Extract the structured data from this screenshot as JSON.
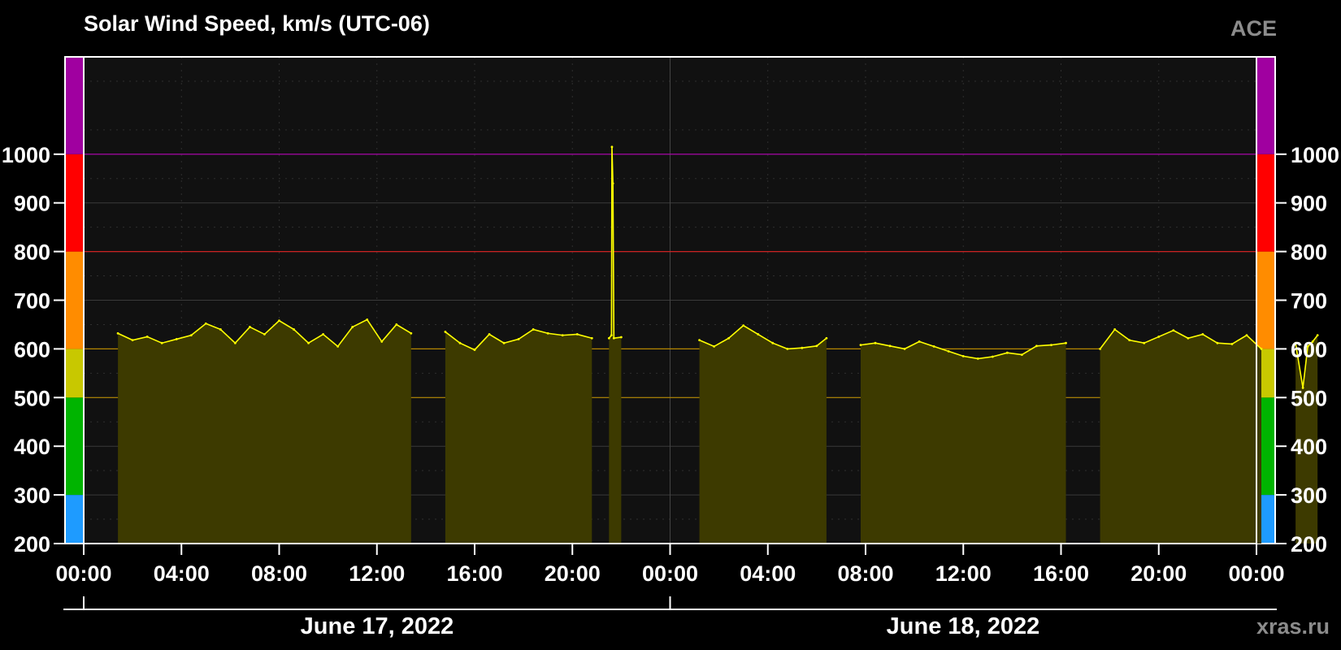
{
  "chart_data": {
    "type": "area",
    "title": "Solar Wind Speed, km/s (UTC-06)",
    "source_label": "ACE",
    "watermark": "xras.ru",
    "ylim": [
      200,
      1200
    ],
    "y_ticks": [
      200,
      300,
      400,
      500,
      600,
      700,
      800,
      900,
      1000
    ],
    "y_tick_labels": [
      "200",
      "300",
      "400",
      "500",
      "600",
      "700",
      "800",
      "900",
      "1000"
    ],
    "x_range_hours": [
      0,
      48
    ],
    "x_tick_hours": [
      0,
      4,
      8,
      12,
      16,
      20,
      24,
      28,
      32,
      36,
      40,
      44,
      48
    ],
    "x_tick_labels": [
      "00:00",
      "04:00",
      "08:00",
      "12:00",
      "16:00",
      "20:00",
      "00:00",
      "04:00",
      "08:00",
      "12:00",
      "16:00",
      "20:00",
      "00:00"
    ],
    "date_labels": [
      "June 17, 2022",
      "June 18, 2022"
    ],
    "threshold_lines": [
      {
        "value": 500,
        "color": "#b38600"
      },
      {
        "value": 600,
        "color": "#b38600"
      },
      {
        "value": 800,
        "color": "#cc2222"
      },
      {
        "value": 1000,
        "color": "#b000b0"
      }
    ],
    "color_bands": [
      {
        "from": 200,
        "to": 300,
        "color": "#1e9bff"
      },
      {
        "from": 300,
        "to": 500,
        "color": "#00b400"
      },
      {
        "from": 500,
        "to": 600,
        "color": "#c8c800"
      },
      {
        "from": 600,
        "to": 800,
        "color": "#ff8c00"
      },
      {
        "from": 800,
        "to": 1000,
        "color": "#ff0000"
      },
      {
        "from": 1000,
        "to": 1200,
        "color": "#a000a0"
      }
    ],
    "series": [
      {
        "color": "#ffff00",
        "fill": "#3d3a00",
        "x_unit": "hours since June 17, 2022 00:00 (UTC-06)",
        "segments": [
          {
            "x": [
              1.4,
              2.0,
              2.6,
              3.2,
              3.8,
              4.4,
              5.0,
              5.6,
              6.2,
              6.8,
              7.4,
              8.0,
              8.6,
              9.2,
              9.8,
              10.4,
              11.0,
              11.6,
              12.2,
              12.8,
              13.4
            ],
            "y": [
              632,
              618,
              625,
              612,
              620,
              628,
              652,
              640,
              612,
              645,
              630,
              658,
              640,
              612,
              630,
              605,
              645,
              660,
              615,
              650,
              632
            ]
          },
          {
            "x": [
              14.8,
              15.4,
              16.0,
              16.6,
              17.2,
              17.8,
              18.4,
              19.0,
              19.6,
              20.2,
              20.8
            ],
            "y": [
              635,
              612,
              598,
              630,
              612,
              620,
              640,
              632,
              628,
              630,
              622
            ]
          },
          {
            "x": [
              21.5,
              21.6,
              21.62,
              21.66,
              21.7,
              22.0
            ],
            "y": [
              622,
              628,
              1015,
              940,
              622,
              624
            ]
          },
          {
            "x": [
              25.2,
              25.8,
              26.4,
              27.0,
              27.6,
              28.2,
              28.8,
              29.4,
              30.0,
              30.4
            ],
            "y": [
              618,
              605,
              622,
              648,
              630,
              612,
              600,
              602,
              606,
              622
            ]
          },
          {
            "x": [
              31.8,
              32.4,
              33.0,
              33.6,
              34.2,
              34.8,
              35.4,
              36.0,
              36.6,
              37.2,
              37.8,
              38.4,
              39.0,
              39.6,
              40.2
            ],
            "y": [
              608,
              612,
              606,
              600,
              615,
              605,
              595,
              585,
              580,
              584,
              592,
              588,
              606,
              608,
              612
            ]
          },
          {
            "x": [
              41.6,
              42.2,
              42.8,
              43.4,
              44.0,
              44.6,
              45.2,
              45.8,
              46.4,
              47.0,
              47.6,
              48.2
            ],
            "y": [
              600,
              640,
              618,
              612,
              625,
              638,
              622,
              630,
              612,
              610,
              628,
              600
            ]
          },
          {
            "x": [
              49.6,
              49.9,
              50.1,
              50.3,
              50.5
            ],
            "y": [
              612,
              520,
              605,
              615,
              628
            ]
          }
        ]
      }
    ]
  }
}
